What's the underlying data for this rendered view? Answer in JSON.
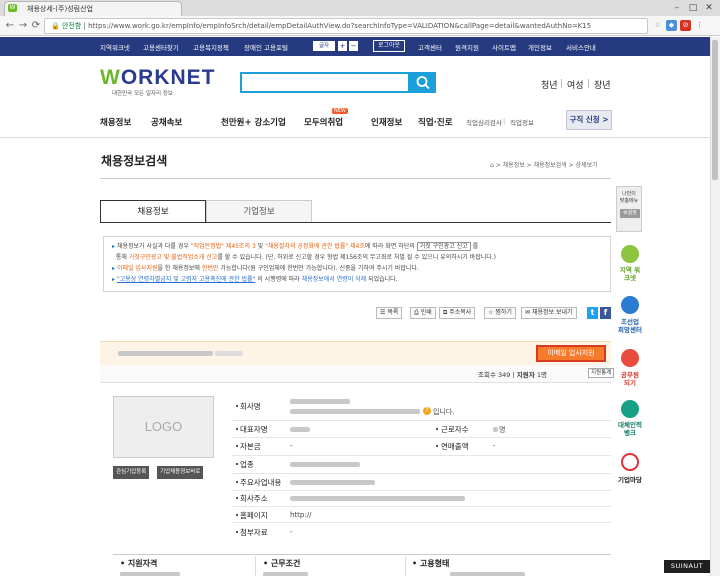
{
  "browser": {
    "tab_title": "채용상세-(주)성림산업",
    "favicon": "W",
    "secure_label": "안전함",
    "url": "https://www.work.go.kr/empInfo/empInfoSrch/detail/empDetailAuthView.do?searchInfoType=VALIDATION&callPage=detail&wantedAuthNo=K15"
  },
  "util_nav": {
    "items": [
      "지역워크넷",
      "고용센터찾기",
      "고용복지정책",
      "장애인 고용포털"
    ],
    "font_label": "글자",
    "logout": "로그아웃",
    "right_items": [
      "고객센터",
      "원격지원",
      "사이트맵",
      "개인정보",
      "서비스안내"
    ]
  },
  "header": {
    "logo_w": "W",
    "logo_rest": "ORKNET",
    "logo_sub": "대한민국 모든 일자리 정보",
    "audience": [
      "청년",
      "여성",
      "장년"
    ]
  },
  "menu": {
    "items": [
      "채용정보",
      "공채속보",
      "천만원+ 강소기업",
      "모두의취업",
      "인재정보",
      "직업·진로"
    ],
    "new_badge": "NEW",
    "sub_items": [
      "직업심리검사",
      "직업정보"
    ],
    "gujik": "구직 신청 >"
  },
  "page": {
    "title": "채용정보검색",
    "breadcrumb": "⌂ > 채용정보 > 채용정보검색 > 상세보기"
  },
  "tabs": [
    "채용정보",
    "기업정보"
  ],
  "notice": {
    "l1a": "채용정보가 사실과 다를 경우 ",
    "l1b": "\"직업안정법\" 제45조의 3",
    "l1c": " 및 ",
    "l1d": "\"채용절차의 공정화에 관한 법률\" 제4조",
    "l1e": "에 따라 화면 하단의 ",
    "l1f": "거짓 구인광고 신고",
    "l1g": " 를",
    "l2a": "통해 ",
    "l2b": "거짓구인광고 및 불법직업소개 신고",
    "l2c": "를 할 수 있습니다. (단, 허위로 신고할 경우 형법 제156조의 무고죄로 처벌 될 수 있으니 유의하시기 바랍니다.)",
    "l3a": "이메일 입사지원",
    "l3b": "을 한 채용정보에 ",
    "l3c": "한번만",
    "l3d": " 가능합니다(원 구인업체에 한번만 가능합니다). 신중을 기하여 주시기 바랍니다.",
    "l4a": "\"고용상 연령차별금지 및 고령자 고용촉진에 관한 법률\"",
    "l4b": " 의 시행령에 따라 ",
    "l4c": "채용정보에서 연령이 삭제",
    "l4d": " 되었습니다."
  },
  "toolbar": {
    "list": "목록",
    "print": "인쇄",
    "address_copy": "주소복사",
    "scrap": "찜하기",
    "mail": "채용정보 보내기",
    "twitter": "t",
    "facebook": "f"
  },
  "job": {
    "apply_button": "이메일 입사지원",
    "views_label": "조회수",
    "views": "349",
    "applicants_label": "지원자",
    "applicants": "1",
    "count_unit": "명",
    "stat_button": "지원통계"
  },
  "company": {
    "logo_placeholder": "LOGO",
    "interest_button": "관심기업등록",
    "other_jobs_button": "기업채용정보바로",
    "fields": {
      "name": "회사명",
      "ceo": "대표자명",
      "capital": "자본금",
      "industry": "업종",
      "business": "주요사업내용",
      "address": "회사주소",
      "homepage": "홈페이지",
      "attachments": "첨부자료"
    },
    "values": {
      "name_suffix": "입니다.",
      "capital": "-",
      "homepage": "http://",
      "attachments": "-"
    },
    "right_fields": {
      "employees": "근로자수",
      "sales": "연매출액"
    },
    "right_values": {
      "employees": "명",
      "sales": "-"
    }
  },
  "bottom_sections": [
    "지원자격",
    "근무조건",
    "고용형태"
  ],
  "side_quick": {
    "title1": "나만의",
    "title2": "맞춤메뉴",
    "setting": "설정",
    "items": [
      "지역 워크넷",
      "조선업 희망센터",
      "공무원 되기",
      "대체인력 뱅크",
      "기업마당"
    ]
  },
  "watermark": "SUINAUT"
}
